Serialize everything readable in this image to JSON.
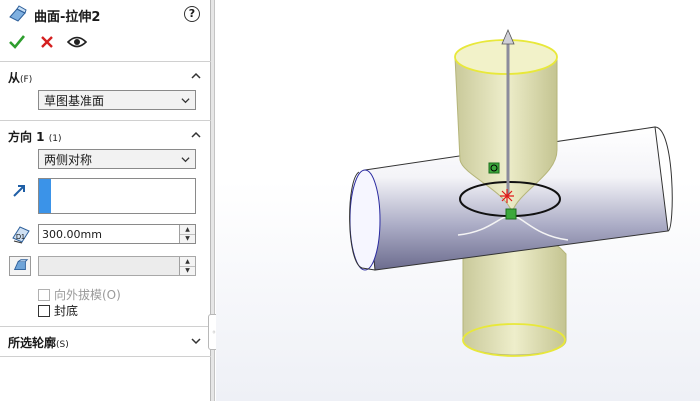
{
  "feature": {
    "title": "曲面-拉伸2",
    "help_label": "?"
  },
  "from_section": {
    "title": "从",
    "hotkey": "(F)",
    "start_condition": "草图基准面"
  },
  "direction1_section": {
    "title": "方向 1",
    "hotkey": "(1)",
    "end_condition": "两侧对称",
    "depth_value": "300.00mm",
    "draft_value": "",
    "draft_outward_label": "向外拔模(O)",
    "cap_ends_label": "封底"
  },
  "contours_section": {
    "title": "所选轮廓",
    "hotkey": "(S)"
  },
  "icons": {
    "feature": "extruded-surface-icon",
    "ok": "green-check-icon",
    "cancel": "red-x-icon",
    "preview": "eye-icon"
  },
  "colors": {
    "accent_blue": "#3b93e8",
    "ok_green": "#2e9e2e",
    "cancel_red": "#d42020",
    "vertical_cylinder": "#dcdcaa",
    "highlight_yellow": "#e8e83a",
    "horizontal_cylinder": "#8f8fb0"
  }
}
